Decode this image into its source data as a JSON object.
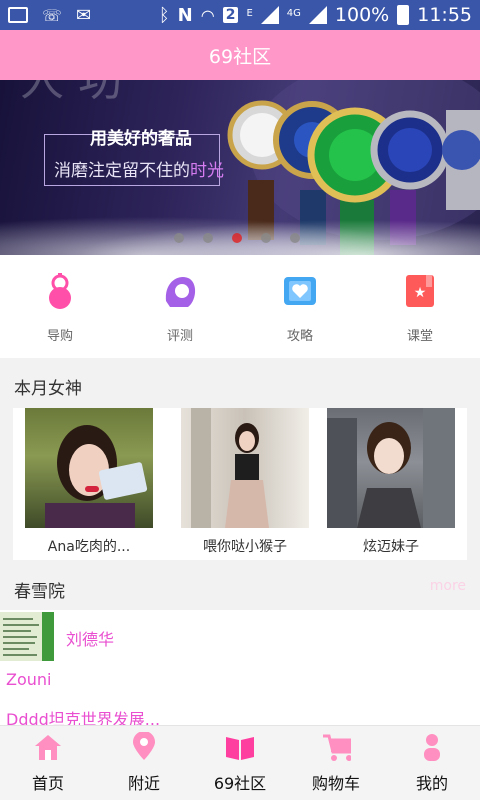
{
  "status_bar": {
    "battery": "100%",
    "time": "11:55",
    "network": "4G",
    "sim": "2",
    "data": "E",
    "icons": [
      "image-icon",
      "missed-call-icon",
      "mail-icon",
      "bluetooth-icon",
      "nfc-icon",
      "wifi-icon",
      "signal-icon",
      "battery-icon"
    ]
  },
  "header": {
    "title": "69社区"
  },
  "banner": {
    "line1": "用美好的奢品",
    "line2_prefix": "消磨注定留不住的",
    "line2_highlight": "时光",
    "slides": 5,
    "active_slide": 3
  },
  "categories": [
    {
      "label": "导购",
      "icon": "gourd-icon",
      "color": "#ff4fa8"
    },
    {
      "label": "评测",
      "icon": "woman-profile-icon",
      "color": "#a560e8"
    },
    {
      "label": "攻略",
      "icon": "heart-card-icon",
      "color": "#44a7f2"
    },
    {
      "label": "课堂",
      "icon": "bookmark-star-icon",
      "color": "#ff5a5a"
    }
  ],
  "goddess": {
    "title": "本月女神",
    "items": [
      {
        "name": "Ana吃肉的..."
      },
      {
        "name": "喂你哒小猴子"
      },
      {
        "name": "炫迈妹子"
      }
    ]
  },
  "spring_snow": {
    "title": "春雪院",
    "more": "more",
    "items": [
      {
        "title": "刘德华"
      },
      {
        "title": "Zouni"
      },
      {
        "title": "Dddd坦克世界发展..."
      }
    ]
  },
  "nav": [
    {
      "label": "首页",
      "icon": "home-icon"
    },
    {
      "label": "附近",
      "icon": "location-pin-icon"
    },
    {
      "label": "69社区",
      "icon": "book-icon"
    },
    {
      "label": "购物车",
      "icon": "cart-icon"
    },
    {
      "label": "我的",
      "icon": "person-icon"
    }
  ],
  "colors": {
    "header": "#ff97c9",
    "status_bar": "#3a56a8",
    "accent": "#e94fd0",
    "nav_icon": "#ff8fc0"
  }
}
